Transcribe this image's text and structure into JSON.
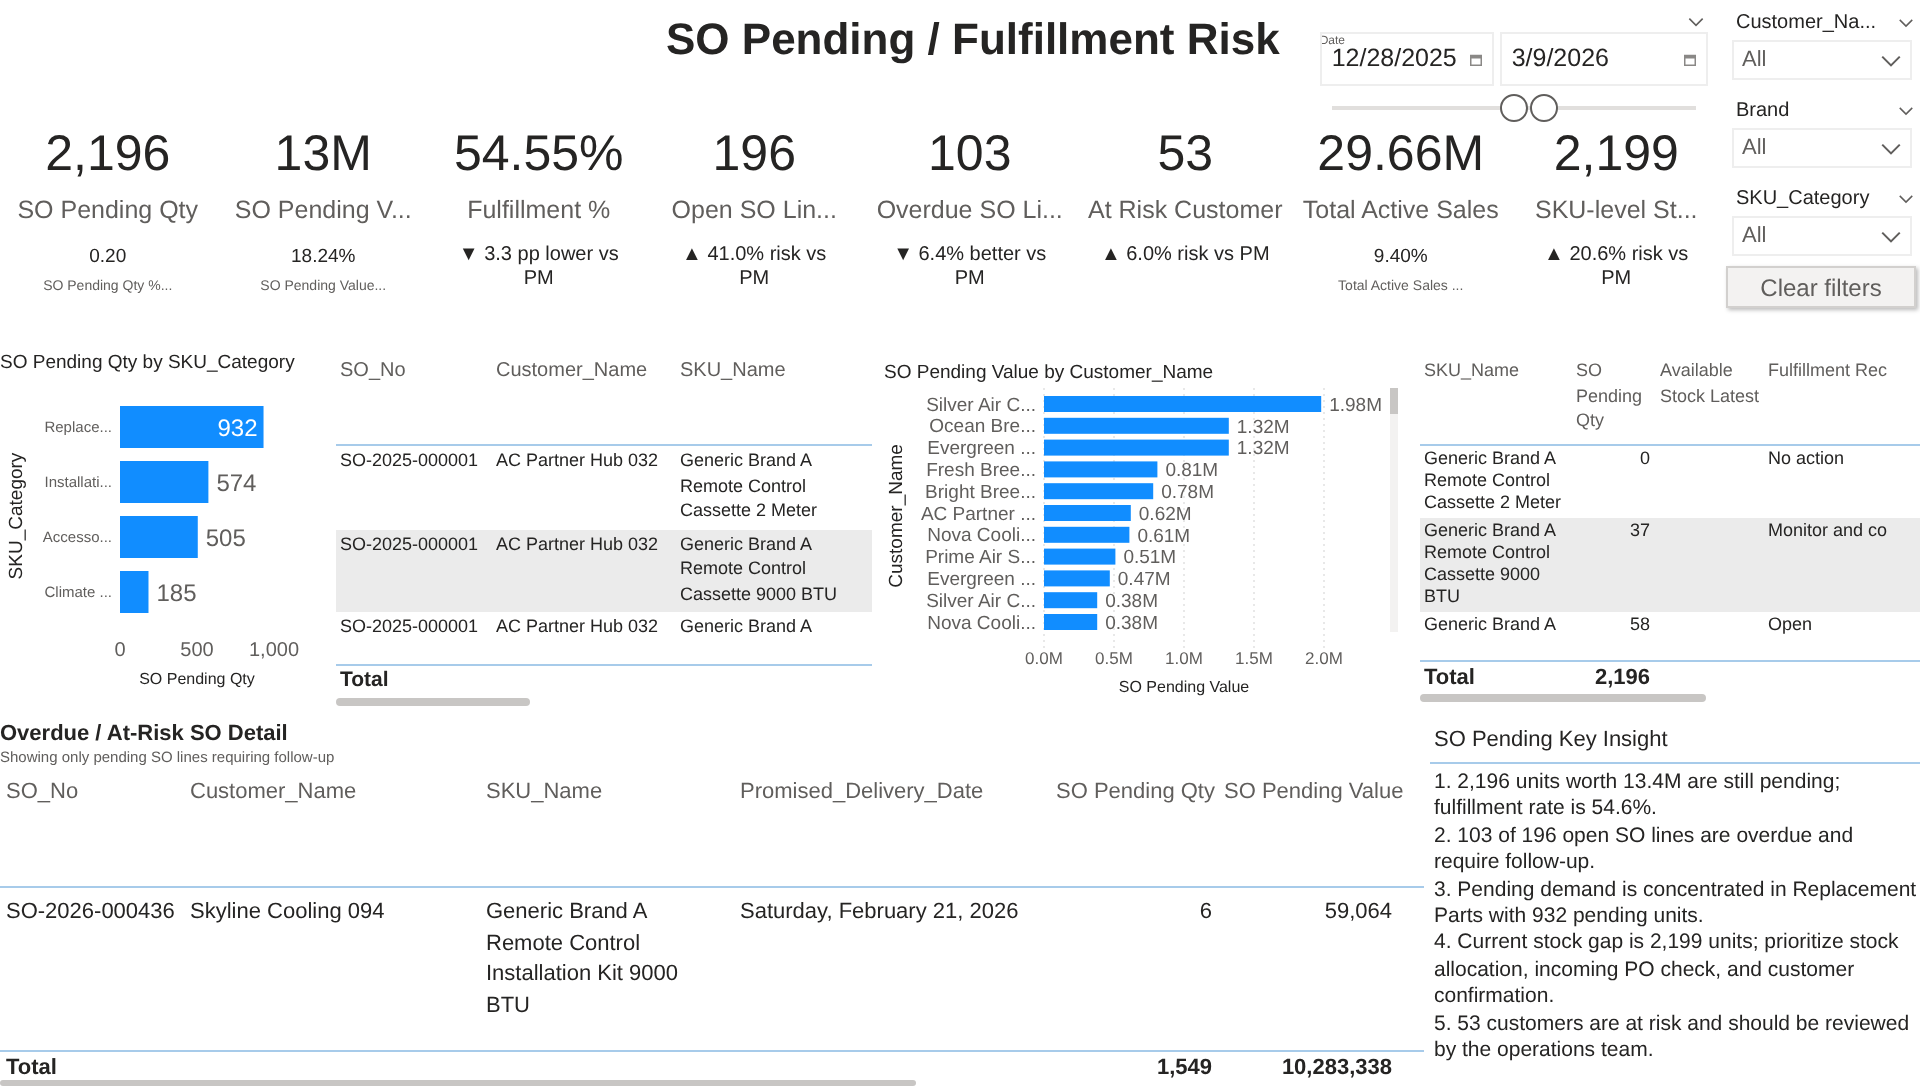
{
  "title": "SO Pending / Fulfillment Risk",
  "date_slicer": {
    "label": "Date",
    "start": "12/28/2025",
    "end": "3/9/2026",
    "thumbs": [
      {
        "level": 0.5
      },
      {
        "level": 0.59
      }
    ]
  },
  "kpis": [
    {
      "kind": "secondary",
      "value": "2,196",
      "label": "SO Pending Qty",
      "sub": "0.20",
      "caption": "SO Pending Qty %..."
    },
    {
      "kind": "secondary",
      "value": "13M",
      "label": "SO Pending V...",
      "sub": "18.24%",
      "caption": "SO Pending Value..."
    },
    {
      "kind": "delta",
      "value": "54.55%",
      "label": "Fulfillment %",
      "sub": "▼ 3.3 pp lower vs PM"
    },
    {
      "kind": "delta",
      "value": "196",
      "label": "Open SO Lin...",
      "sub": "▲ 41.0% risk vs PM"
    },
    {
      "kind": "delta",
      "value": "103",
      "label": "Overdue SO Li...",
      "sub": "▼ 6.4% better vs PM"
    },
    {
      "kind": "delta",
      "value": "53",
      "label": "At Risk Customer",
      "sub": "▲ 6.0% risk vs PM"
    },
    {
      "kind": "secondary",
      "value": "29.66M",
      "label": "Total Active Sales",
      "sub": "9.40%",
      "caption": "Total Active Sales ..."
    },
    {
      "kind": "delta",
      "value": "2,199",
      "label": "SKU-level St...",
      "sub": "▲ 20.6% risk vs PM"
    }
  ],
  "slicers": [
    {
      "label": "Customer_Na...",
      "value": "All"
    },
    {
      "label": "Brand",
      "value": "All"
    },
    {
      "label": "SKU_Category",
      "value": "All"
    }
  ],
  "clear_button": "Clear filters",
  "category_chart": {
    "title": "SO Pending Qty by SKU_Category",
    "chart_data": {
      "type": "bar",
      "orientation": "horizontal",
      "xlabel": "SO Pending Qty",
      "ylabel": "SKU_Category",
      "categories": [
        "Replace...",
        "Installati...",
        "Accesso...",
        "Climate ..."
      ],
      "values": [
        932,
        574,
        505,
        185
      ],
      "xlim": [
        0,
        1000
      ],
      "xticks": [
        0,
        500,
        {
          "value": 1000,
          "label": "1,000"
        }
      ],
      "data_labels": true
    }
  },
  "so_table": {
    "columns": [
      "SO_No",
      "Customer_Name",
      "SKU_Name"
    ],
    "rows": [
      [
        "SO-2025-000001",
        "AC Partner Hub 032",
        "Generic Brand A Remote Control Cassette 2 Meter"
      ],
      [
        "SO-2025-000001",
        "AC Partner Hub 032",
        "Generic Brand A Remote Control Cassette 9000 BTU"
      ],
      [
        "SO-2025-000001",
        "AC Partner Hub 032",
        "Generic Brand A"
      ]
    ],
    "total_label": "Total"
  },
  "customer_chart": {
    "title": "SO Pending Value by Customer_Name",
    "chart_data": {
      "type": "bar",
      "orientation": "horizontal",
      "grid": true,
      "xlabel": "SO Pending Value",
      "ylabel": "Customer_Name",
      "categories": [
        "Silver Air C...",
        "Ocean Bre...",
        "Evergreen ...",
        "Fresh Bree...",
        "Bright Bree...",
        "AC Partner ...",
        "Nova Cooli...",
        "Prime Air S...",
        "Evergreen ...",
        "Silver Air C...",
        "Nova Cooli..."
      ],
      "values": [
        1980000,
        1320000,
        1320000,
        810000,
        780000,
        620000,
        610000,
        510000,
        470000,
        380000,
        380000
      ],
      "xlim": [
        0,
        2000000
      ],
      "xticks": [
        {
          "value": 0,
          "label": "0.0M"
        },
        {
          "value": 500000,
          "label": "0.5M"
        },
        {
          "value": 1000000,
          "label": "1.0M"
        },
        {
          "value": 1500000,
          "label": "1.5M"
        },
        {
          "value": 2000000,
          "label": "2.0M"
        }
      ],
      "value_labels": [
        "1.98M",
        "1.32M",
        "1.32M",
        "0.81M",
        "0.78M",
        "0.62M",
        "0.61M",
        "0.51M",
        "0.47M",
        "0.38M",
        "0.38M"
      ]
    }
  },
  "stock_table": {
    "columns": [
      "SKU_Name",
      "SO Pending Qty",
      "Available Stock Latest",
      "Fulfillment Rec"
    ],
    "rows": [
      {
        "sku": "Generic Brand A Remote Control Cassette 2 Meter",
        "qty": "0",
        "action": "No action"
      },
      {
        "sku": "Generic Brand A Remote Control Cassette 9000 BTU",
        "qty": "37",
        "action": "Monitor and co"
      },
      {
        "sku": "Generic Brand A",
        "qty": "58",
        "action": "Open"
      }
    ],
    "total_label": "Total",
    "total_qty": "2,196"
  },
  "detail": {
    "title": "Overdue / At-Risk SO Detail",
    "subtitle": "Showing only pending SO lines requiring follow-up",
    "columns": [
      "SO_No",
      "Customer_Name",
      "SKU_Name",
      "Promised_Delivery_Date",
      "SO Pending Qty",
      "SO Pending Value"
    ],
    "rows": [
      [
        "SO-2026-000436",
        "Skyline Cooling 094",
        "Generic Brand A Remote Control Installation Kit 9000 BTU",
        "Saturday, February 21, 2026",
        "6",
        "59,064"
      ]
    ],
    "total": [
      "Total",
      "1,549",
      "10,283,338"
    ]
  },
  "insight": {
    "title": "SO Pending Key Insight",
    "lines": [
      "1. 2,196 units worth 13.4M are still pending; fulfillment rate is 54.6%.",
      "2. 103 of 196 open SO lines are overdue and require follow-up.",
      "3. Pending demand is concentrated in Replacement Parts with 932 pending units.",
      "4. Current stock gap is 2,199 units; prioritize stock allocation, incoming PO check, and customer confirmation.",
      "5. 53 customers are at risk and should be reviewed by the operations team."
    ]
  }
}
